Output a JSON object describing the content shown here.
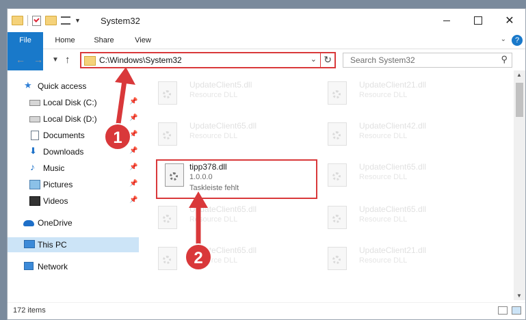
{
  "window": {
    "title": "System32"
  },
  "ribbon": {
    "tabs": [
      "File",
      "Home",
      "Share",
      "View"
    ]
  },
  "address": {
    "path": "C:\\Windows\\System32",
    "search_placeholder": "Search System32"
  },
  "sidebar": {
    "items": [
      {
        "label": "Quick access",
        "icon": "star-icon",
        "pinned": false
      },
      {
        "label": "Local Disk (C:)",
        "icon": "disk-icon",
        "pinned": true
      },
      {
        "label": "Local Disk (D:)",
        "icon": "disk-icon",
        "pinned": true
      },
      {
        "label": "Documents",
        "icon": "documents-icon",
        "pinned": true
      },
      {
        "label": "Downloads",
        "icon": "downloads-icon",
        "pinned": true
      },
      {
        "label": "Music",
        "icon": "music-icon",
        "pinned": true
      },
      {
        "label": "Pictures",
        "icon": "pictures-icon",
        "pinned": true
      },
      {
        "label": "Videos",
        "icon": "videos-icon",
        "pinned": true
      },
      {
        "label": "OneDrive",
        "icon": "onedrive-icon",
        "pinned": false
      },
      {
        "label": "This PC",
        "icon": "this-pc-icon",
        "pinned": false,
        "selected": true
      },
      {
        "label": "Network",
        "icon": "network-icon",
        "pinned": false
      }
    ]
  },
  "files": [
    {
      "name": "UpdateClient5.dll",
      "type": "Resource DLL"
    },
    {
      "name": "UpdateClient21.dll",
      "type": "Resource DLL"
    },
    {
      "name": "UpdateClient65.dll",
      "type": "Resource DLL"
    },
    {
      "name": "UpdateClient42.dll",
      "type": "Resource DLL"
    },
    {
      "name": "tipp378.dll",
      "type": "1.0.0.0",
      "desc": "Taskleiste fehlt",
      "highlighted": true
    },
    {
      "name": "UpdateClient65.dll",
      "type": "Resource DLL"
    },
    {
      "name": "UpdateClient65.dll",
      "type": "Resource DLL"
    },
    {
      "name": "UpdateClient65.dll",
      "type": "Resource DLL"
    },
    {
      "name": "UpdateClient65.dll",
      "type": "Resource DLL"
    },
    {
      "name": "UpdateClient21.dll",
      "type": "Resource DLL"
    }
  ],
  "status": {
    "count": "172 items"
  },
  "callouts": [
    "1",
    "2"
  ],
  "colors": {
    "accent": "#1979ca",
    "highlight": "#d9383a",
    "selected": "#cce4f7"
  }
}
